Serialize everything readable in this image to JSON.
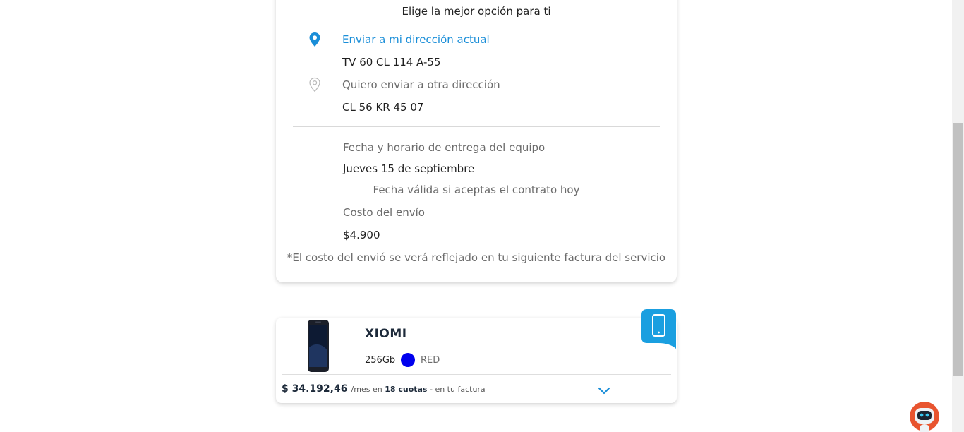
{
  "delivery": {
    "heading": "Elige la mejor opción para ti",
    "options": [
      {
        "label": "Enviar a mi dirección actual",
        "address": "TV 60 CL 114 A-55",
        "icon": "map-pin-filled-icon",
        "color": "#1a8ed8"
      },
      {
        "label": "Quiero enviar a otra dirección",
        "address": "CL 56 KR 45 07",
        "icon": "map-pin-outline-icon",
        "color": "#b8b8b8"
      }
    ],
    "date_label": "Fecha y horario de entrega del equipo",
    "date_value": "Jueves 15 de septiembre",
    "date_note": "Fecha válida si aceptas el contrato hoy",
    "cost_label": "Costo del envío",
    "cost_value": "$4.900",
    "cost_note": "*El costo del envió se verá reflejado en tu siguiente factura del servicio"
  },
  "product": {
    "name": "XIOMI",
    "storage": "256Gb",
    "color_name": "RED",
    "color_swatch": "#0000ee",
    "price": "$ 34.192,46",
    "price_per": "/mes en",
    "installments": "18 cuotas",
    "price_suffix": "- en tu factura",
    "badge_icon": "smartphone-icon",
    "badge_color": "#1a9fe0"
  },
  "chatbot": {
    "icon": "robot-assistant-icon"
  }
}
